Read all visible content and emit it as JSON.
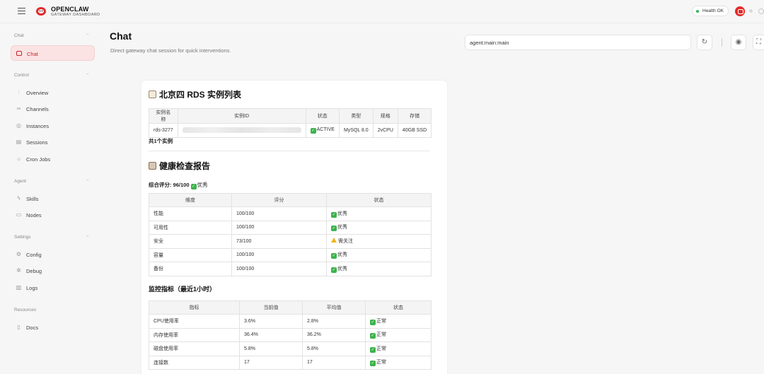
{
  "app": {
    "brand_title": "OPENCLAW",
    "brand_sub": "GATEWAY DASHBOARD",
    "health_label": "Health",
    "health_value": "OK",
    "accent": "#e22a2a"
  },
  "sidebar": {
    "sections": [
      {
        "label": "Chat",
        "items": [
          {
            "label": "Chat",
            "icon": "chat-icon",
            "active": true
          }
        ]
      },
      {
        "label": "Control",
        "items": [
          {
            "label": "Overview",
            "icon": "bar-chart-icon"
          },
          {
            "label": "Channels",
            "icon": "link-icon"
          },
          {
            "label": "Instances",
            "icon": "broadcast-icon"
          },
          {
            "label": "Sessions",
            "icon": "document-icon"
          },
          {
            "label": "Cron Jobs",
            "icon": "sun-icon"
          }
        ]
      },
      {
        "label": "Agent",
        "items": [
          {
            "label": "Skills",
            "icon": "bolt-icon"
          },
          {
            "label": "Nodes",
            "icon": "monitor-icon"
          }
        ]
      },
      {
        "label": "Settings",
        "items": [
          {
            "label": "Config",
            "icon": "gear-icon"
          },
          {
            "label": "Debug",
            "icon": "bug-icon"
          },
          {
            "label": "Logs",
            "icon": "file-text-icon"
          }
        ]
      },
      {
        "label": "Resources",
        "items": [
          {
            "label": "Docs",
            "icon": "book-icon"
          }
        ]
      }
    ]
  },
  "main": {
    "title": "Chat",
    "subtitle": "Direct gateway chat session for quick interventions.",
    "session_value": "agent:main:main"
  },
  "message": {
    "instances": {
      "heading": "北京四 RDS 实例列表",
      "headers": [
        "实例名称",
        "实例ID",
        "状态",
        "类型",
        "规格",
        "存储"
      ],
      "row": {
        "name": "rds-3277",
        "status": "ACTIVE",
        "type": "MySQL 8.0",
        "spec": "2vCPU",
        "storage": "40GB SSD"
      },
      "count": "共1个实例"
    },
    "health": {
      "heading": "健康检查报告",
      "score_label": "综合评分: 96/100",
      "score_status": "优秀",
      "headers": [
        "维度",
        "评分",
        "状态"
      ],
      "rows": [
        {
          "dim": "性能",
          "score": "100/100",
          "status": "优秀",
          "level": "ok"
        },
        {
          "dim": "可用性",
          "score": "100/100",
          "status": "优秀",
          "level": "ok"
        },
        {
          "dim": "安全",
          "score": "73/100",
          "status": "需关注",
          "level": "warn"
        },
        {
          "dim": "容量",
          "score": "100/100",
          "status": "优秀",
          "level": "ok"
        },
        {
          "dim": "备份",
          "score": "100/100",
          "status": "优秀",
          "level": "ok"
        }
      ]
    },
    "metrics": {
      "heading": "监控指标（最近1小时）",
      "headers": [
        "指标",
        "当前值",
        "平均值",
        "状态"
      ],
      "rows": [
        {
          "name": "CPU使用率",
          "current": "3.6%",
          "avg": "2.8%",
          "status": "正常"
        },
        {
          "name": "内存使用率",
          "current": "36.4%",
          "avg": "36.2%",
          "status": "正常"
        },
        {
          "name": "磁盘使用率",
          "current": "5.8%",
          "avg": "5.8%",
          "status": "正常"
        },
        {
          "name": "连接数",
          "current": "17",
          "avg": "17",
          "status": "正常"
        }
      ]
    }
  }
}
